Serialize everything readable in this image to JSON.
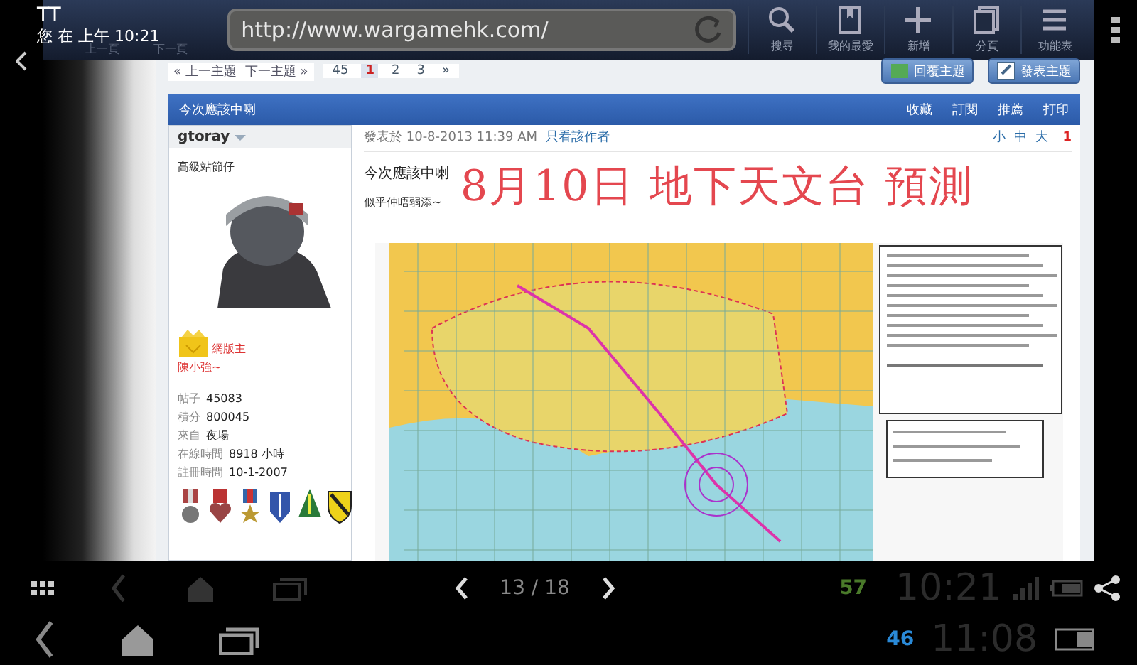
{
  "notification": {
    "title": "TT",
    "text": "您 在 上午 10:21"
  },
  "browser": {
    "nav": [
      {
        "label": "上一頁"
      },
      {
        "label": "下一頁"
      }
    ],
    "url": "http://www.wargamehk.com/",
    "tools": [
      {
        "kind": "search",
        "label": "搜尋"
      },
      {
        "kind": "bookmark",
        "label": "我的最愛"
      },
      {
        "kind": "add",
        "label": "新增"
      },
      {
        "kind": "tabs",
        "label": "分頁"
      },
      {
        "kind": "menu",
        "label": "功能表"
      }
    ]
  },
  "thread_nav": {
    "links": [
      "« 上一主題",
      "下一主題 »"
    ],
    "pages": [
      {
        "label": "45",
        "selected": false
      },
      {
        "label": "1",
        "selected": true
      },
      {
        "label": "2",
        "selected": false
      },
      {
        "label": "3",
        "selected": false
      },
      {
        "label": "»",
        "selected": false
      }
    ],
    "buttons": [
      {
        "kind": "reply",
        "label": "回覆主題"
      },
      {
        "kind": "new",
        "label": "發表主題"
      }
    ]
  },
  "thread": {
    "title": "今次應該中喇",
    "actions": [
      "收藏",
      "訂閱",
      "推薦",
      "打印"
    ]
  },
  "post": {
    "author": {
      "name": "gtoray",
      "rank": "高級站節仔",
      "group": "網版主",
      "nickname": "陳小強~",
      "stats": [
        {
          "label": "帖子",
          "value": "45083"
        },
        {
          "label": "積分",
          "value": "800045"
        },
        {
          "label": "來自",
          "value": "夜場"
        },
        {
          "label": "在線時間",
          "value": "8918 小時"
        },
        {
          "label": "註冊時間",
          "value": "10-1-2007"
        }
      ],
      "medals": [
        {
          "kind": "cross"
        },
        {
          "kind": "heart"
        },
        {
          "kind": "star"
        },
        {
          "kind": "shield"
        },
        {
          "kind": "arrowhead"
        },
        {
          "kind": "cavalry"
        }
      ]
    },
    "posted": "發表於 10-8-2013 11:39 AM",
    "author_only": "只看該作者",
    "font_sizes": [
      "小",
      "中",
      "大"
    ],
    "floor": "1",
    "title": "今次應該中喇",
    "text": "似乎仲唔弱添~",
    "handwriting": "8月10日 地下天文台 預測"
  },
  "viewer": {
    "counter": "13 / 18"
  },
  "status": {
    "battery": "57",
    "time": "10:21"
  },
  "system": {
    "battery": "46",
    "time": "11:08"
  }
}
